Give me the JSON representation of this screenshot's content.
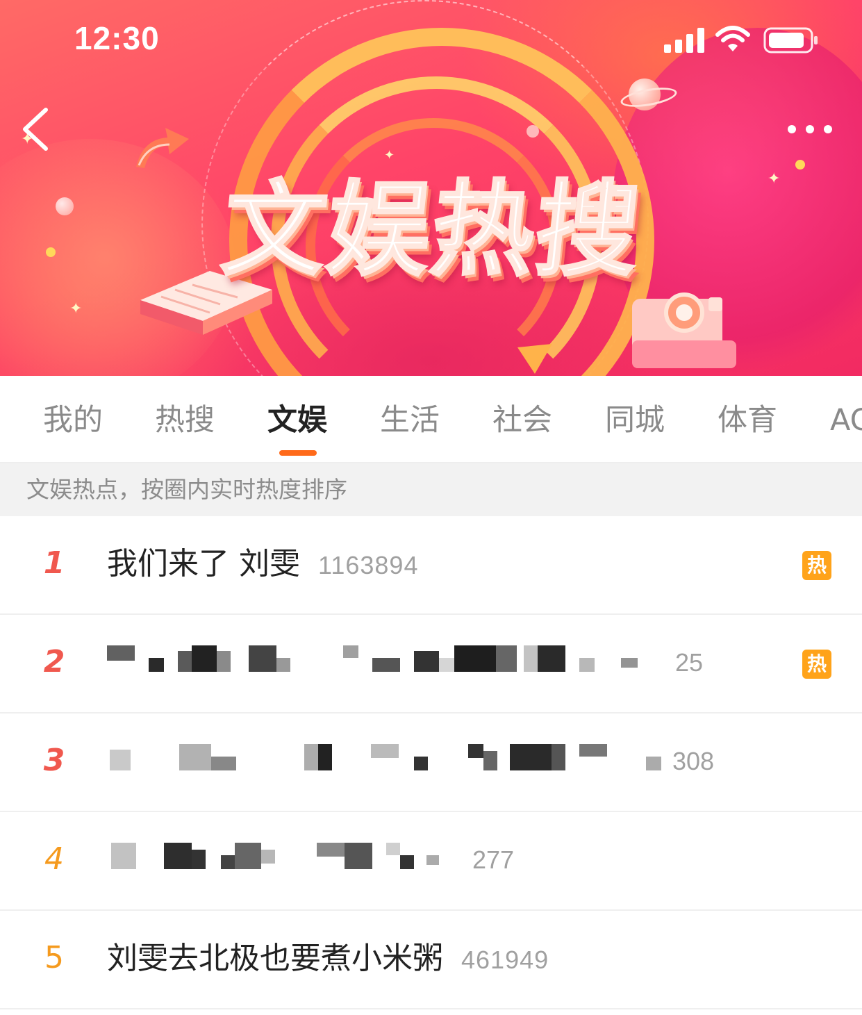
{
  "status_bar": {
    "time": "12:30"
  },
  "banner": {
    "title": "文娱热搜",
    "colors": {
      "primary": "#ff4468",
      "accent": "#ffc35a"
    }
  },
  "nav": {
    "back_icon": "chevron-left-icon",
    "more_icon": "more-dots-icon"
  },
  "tabs": [
    {
      "label": "我的",
      "active": false
    },
    {
      "label": "热搜",
      "active": false
    },
    {
      "label": "文娱",
      "active": true
    },
    {
      "label": "生活",
      "active": false
    },
    {
      "label": "社会",
      "active": false
    },
    {
      "label": "同城",
      "active": false
    },
    {
      "label": "体育",
      "active": false
    },
    {
      "label": "AC",
      "active": false
    }
  ],
  "subtitle": "文娱热点，按圈内实时热度排序",
  "list": [
    {
      "rank": "1",
      "topic": "我们来了 刘雯",
      "count": "1163894",
      "badge": "热"
    },
    {
      "rank": "2",
      "topic": "",
      "count": "25",
      "badge": "热",
      "masked": true
    },
    {
      "rank": "3",
      "topic": "",
      "count": "308",
      "badge": "",
      "masked": true
    },
    {
      "rank": "4",
      "topic": "",
      "count": "277",
      "badge": "",
      "masked": true
    },
    {
      "rank": "5",
      "topic": "刘雯去北极也要煮小米粥",
      "count": "461949",
      "badge": ""
    }
  ],
  "theme": {
    "tab_indicator": "#ff6a1a",
    "rank_top": "#f0584e",
    "rank_other": "#f59a1e",
    "hot_badge": "#ffa31a"
  }
}
